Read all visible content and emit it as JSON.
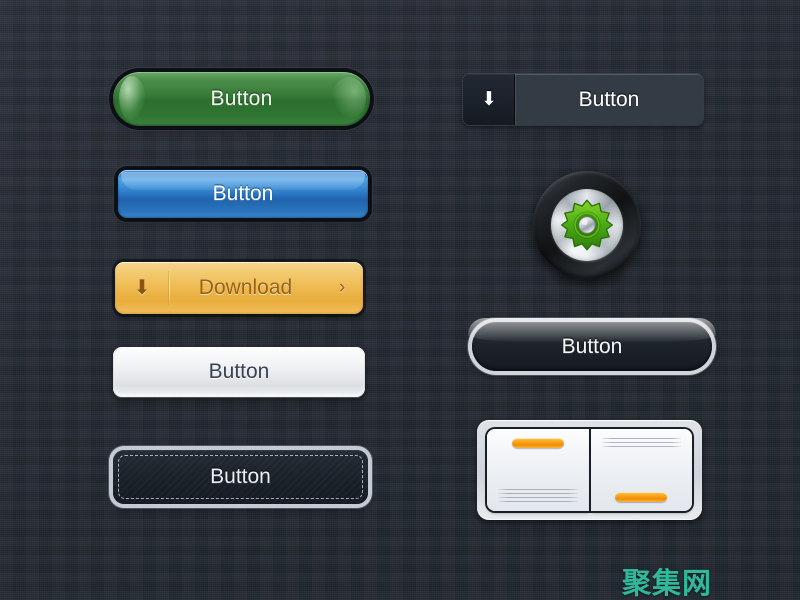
{
  "background": {
    "color": "#272d36",
    "style": "dark woven texture"
  },
  "left_column": {
    "green_button": {
      "label": "Button",
      "color": "#2c6e2e",
      "shape": "pill"
    },
    "blue_button": {
      "label": "Button",
      "color": "#2064ad",
      "shape": "rounded-rect"
    },
    "download_button": {
      "label": "Download",
      "icon": "download-arrow-icon",
      "icon_glyph": "⬇",
      "chevron_glyph": "›",
      "color": "#eeb94f",
      "shape": "rounded-rect"
    },
    "white_button": {
      "label": "Button",
      "color": "#e7e9ec",
      "shape": "rounded-rect"
    },
    "stitched_button": {
      "label": "Button",
      "color": "#1b222a",
      "border_color": "#c3cad4",
      "shape": "rounded-rect-stitched"
    }
  },
  "right_column": {
    "split_button": {
      "label": "Button",
      "icon": "download-arrow-icon",
      "icon_glyph": "⬇",
      "color": "#333b45",
      "shape": "split-rect"
    },
    "gear_knob": {
      "name": "settings-knob",
      "gear_color": "#4caf16",
      "bezel_color": "#101214",
      "dial_color": "#e6eaee"
    },
    "chrome_button": {
      "label": "Button",
      "color": "#1e242c",
      "border_color": "#cfd4da",
      "shape": "pill-chrome"
    },
    "card_panel": {
      "panel_color": "#cfd4da",
      "accent_color": "#ef8c06",
      "cards": [
        {
          "position": "left",
          "accent_position": "top",
          "line_count": 4
        },
        {
          "position": "right",
          "accent_position": "bottom",
          "line_count": 3
        }
      ]
    }
  },
  "watermark": {
    "text": "聚集网",
    "color": "#2fb89a"
  }
}
